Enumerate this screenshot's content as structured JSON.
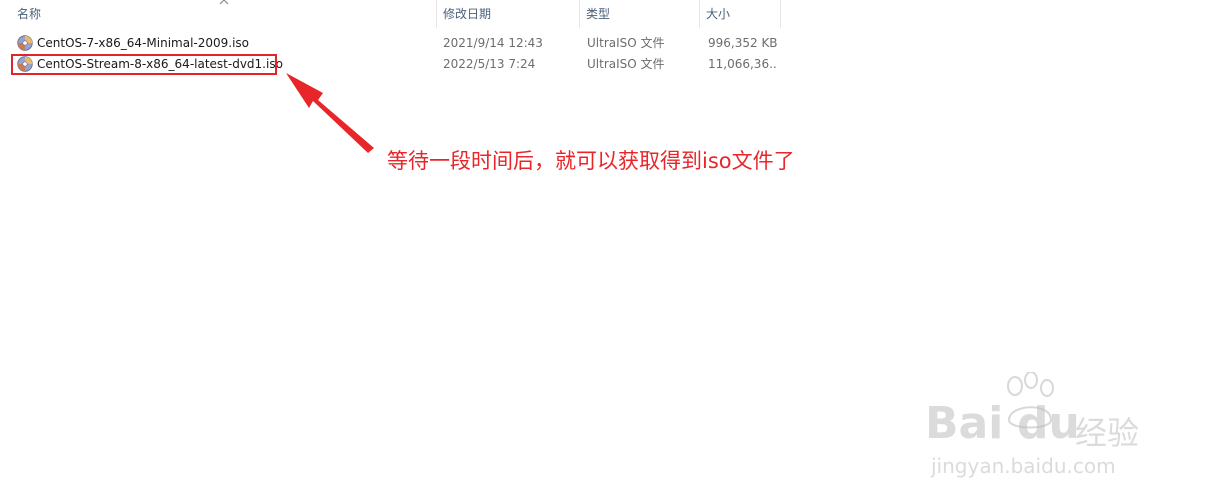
{
  "columns": {
    "name": "名称",
    "date": "修改日期",
    "type": "类型",
    "size": "大小"
  },
  "files": [
    {
      "name": "CentOS-7-x86_64-Minimal-2009.iso",
      "date": "2021/9/14 12:43",
      "type": "UltraISO 文件",
      "size": "996,352 KB",
      "icon": "iso-disc-icon"
    },
    {
      "name": "CentOS-Stream-8-x86_64-latest-dvd1.iso",
      "date": "2022/5/13 7:24",
      "type": "UltraISO 文件",
      "size": "11,066,36...",
      "icon": "iso-disc-icon"
    }
  ],
  "annotation": {
    "text": "等待一段时间后，就可以获取得到iso文件了",
    "color": "#e8262a"
  },
  "watermark": {
    "brand": "Bai",
    "brand2": "du",
    "suffix": "经验",
    "url": "jingyan.baidu.com"
  },
  "colors": {
    "header_text": "#4c607a",
    "highlight": "#e0242a"
  }
}
